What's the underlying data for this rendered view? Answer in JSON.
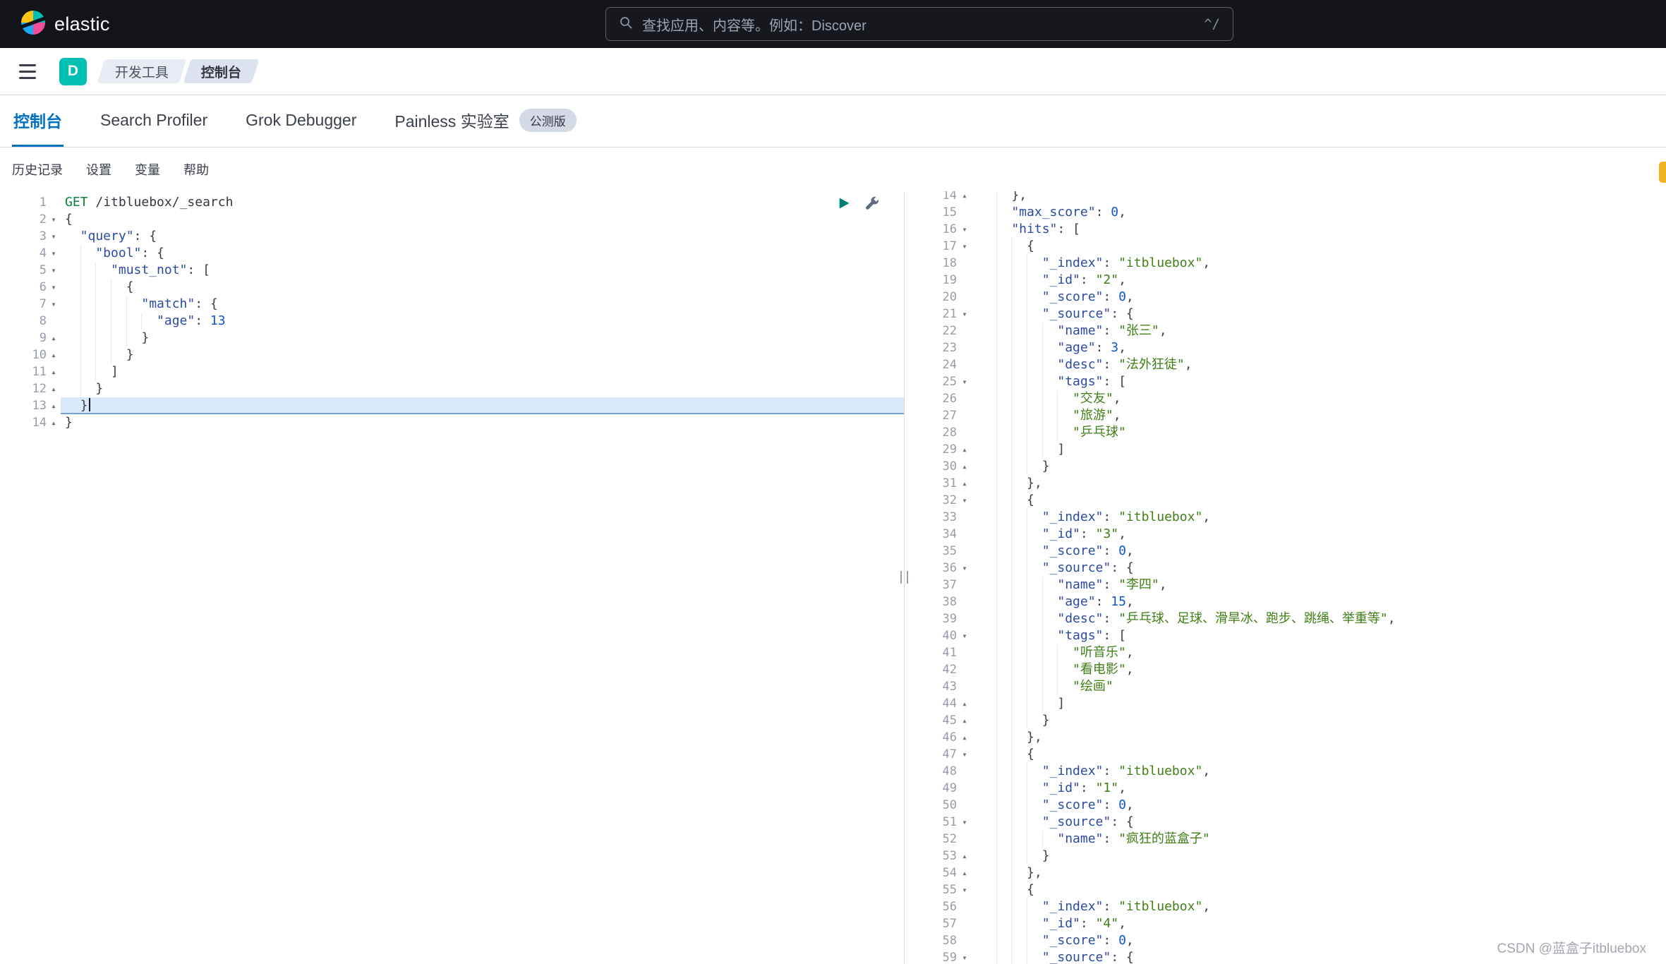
{
  "topbar": {
    "logo_text": "elastic",
    "search_placeholder": "查找应用、内容等。例如：Discover",
    "shortcut_hint": "^/"
  },
  "breadcrumb_bar": {
    "space_initial": "D",
    "breadcrumbs": [
      {
        "id": "dev-tools",
        "label": "开发工具"
      },
      {
        "id": "console",
        "label": "控制台"
      }
    ]
  },
  "tabs": {
    "items": [
      {
        "id": "console",
        "label": "控制台",
        "active": true
      },
      {
        "id": "search-profiler",
        "label": "Search Profiler",
        "active": false
      },
      {
        "id": "grok-debugger",
        "label": "Grok Debugger",
        "active": false
      },
      {
        "id": "painless-lab",
        "label": "Painless 实验室",
        "active": false,
        "badge": "公测版"
      }
    ]
  },
  "console_menu": {
    "items": [
      {
        "id": "history",
        "label": "历史记录"
      },
      {
        "id": "settings",
        "label": "设置"
      },
      {
        "id": "variables",
        "label": "变量"
      },
      {
        "id": "help",
        "label": "帮助"
      }
    ]
  },
  "editor": {
    "request": {
      "active_line": 13,
      "actions": [
        {
          "icon": "play-icon"
        },
        {
          "icon": "wrench-icon"
        }
      ],
      "lines": [
        {
          "n": 1,
          "i": 0,
          "f": "",
          "t": [
            [
              "meth",
              "GET"
            ],
            [
              "pun",
              " "
            ],
            [
              "url",
              "/itbluebox/_search"
            ]
          ]
        },
        {
          "n": 2,
          "i": 0,
          "f": "d",
          "t": [
            [
              "pun",
              "{"
            ]
          ]
        },
        {
          "n": 3,
          "i": 2,
          "f": "d",
          "t": [
            [
              "key",
              "\"query\""
            ],
            [
              "pun",
              ": {"
            ]
          ]
        },
        {
          "n": 4,
          "i": 4,
          "f": "d",
          "t": [
            [
              "key",
              "\"bool\""
            ],
            [
              "pun",
              ": {"
            ]
          ]
        },
        {
          "n": 5,
          "i": 6,
          "f": "d",
          "t": [
            [
              "key",
              "\"must_not\""
            ],
            [
              "pun",
              ": ["
            ]
          ]
        },
        {
          "n": 6,
          "i": 8,
          "f": "d",
          "t": [
            [
              "pun",
              "{"
            ]
          ]
        },
        {
          "n": 7,
          "i": 10,
          "f": "d",
          "t": [
            [
              "key",
              "\"match\""
            ],
            [
              "pun",
              ": {"
            ]
          ]
        },
        {
          "n": 8,
          "i": 12,
          "f": "",
          "t": [
            [
              "key",
              "\"age\""
            ],
            [
              "pun",
              ": "
            ],
            [
              "num",
              "13"
            ]
          ]
        },
        {
          "n": 9,
          "i": 10,
          "f": "u",
          "t": [
            [
              "pun",
              "}"
            ]
          ]
        },
        {
          "n": 10,
          "i": 8,
          "f": "u",
          "t": [
            [
              "pun",
              "}"
            ]
          ]
        },
        {
          "n": 11,
          "i": 6,
          "f": "u",
          "t": [
            [
              "pun",
              "]"
            ]
          ]
        },
        {
          "n": 12,
          "i": 4,
          "f": "u",
          "t": [
            [
              "pun",
              "}"
            ]
          ]
        },
        {
          "n": 13,
          "i": 2,
          "f": "u",
          "t": [
            [
              "pun",
              "}"
            ]
          ],
          "active": true,
          "caret": true
        },
        {
          "n": 14,
          "i": 0,
          "f": "u",
          "t": [
            [
              "pun",
              "}"
            ]
          ]
        }
      ]
    },
    "response": {
      "lines": [
        {
          "n": 14,
          "i": 4,
          "f": "u",
          "t": [
            [
              "pun",
              "},"
            ]
          ]
        },
        {
          "n": 15,
          "i": 4,
          "f": "",
          "t": [
            [
              "key",
              "\"max_score\""
            ],
            [
              "pun",
              ": "
            ],
            [
              "num",
              "0"
            ],
            [
              "pun",
              ","
            ]
          ]
        },
        {
          "n": 16,
          "i": 4,
          "f": "d",
          "t": [
            [
              "key",
              "\"hits\""
            ],
            [
              "pun",
              ": ["
            ]
          ]
        },
        {
          "n": 17,
          "i": 6,
          "f": "d",
          "t": [
            [
              "pun",
              "{"
            ]
          ]
        },
        {
          "n": 18,
          "i": 8,
          "f": "",
          "t": [
            [
              "key",
              "\"_index\""
            ],
            [
              "pun",
              ": "
            ],
            [
              "str",
              "\"itbluebox\""
            ],
            [
              "pun",
              ","
            ]
          ]
        },
        {
          "n": 19,
          "i": 8,
          "f": "",
          "t": [
            [
              "key",
              "\"_id\""
            ],
            [
              "pun",
              ": "
            ],
            [
              "str",
              "\"2\""
            ],
            [
              "pun",
              ","
            ]
          ]
        },
        {
          "n": 20,
          "i": 8,
          "f": "",
          "t": [
            [
              "key",
              "\"_score\""
            ],
            [
              "pun",
              ": "
            ],
            [
              "num",
              "0"
            ],
            [
              "pun",
              ","
            ]
          ]
        },
        {
          "n": 21,
          "i": 8,
          "f": "d",
          "t": [
            [
              "key",
              "\"_source\""
            ],
            [
              "pun",
              ": {"
            ]
          ]
        },
        {
          "n": 22,
          "i": 10,
          "f": "",
          "t": [
            [
              "key",
              "\"name\""
            ],
            [
              "pun",
              ": "
            ],
            [
              "str",
              "\"张三\""
            ],
            [
              "pun",
              ","
            ]
          ]
        },
        {
          "n": 23,
          "i": 10,
          "f": "",
          "t": [
            [
              "key",
              "\"age\""
            ],
            [
              "pun",
              ": "
            ],
            [
              "num",
              "3"
            ],
            [
              "pun",
              ","
            ]
          ]
        },
        {
          "n": 24,
          "i": 10,
          "f": "",
          "t": [
            [
              "key",
              "\"desc\""
            ],
            [
              "pun",
              ": "
            ],
            [
              "str",
              "\"法外狂徒\""
            ],
            [
              "pun",
              ","
            ]
          ]
        },
        {
          "n": 25,
          "i": 10,
          "f": "d",
          "t": [
            [
              "key",
              "\"tags\""
            ],
            [
              "pun",
              ": ["
            ]
          ]
        },
        {
          "n": 26,
          "i": 12,
          "f": "",
          "t": [
            [
              "str",
              "\"交友\""
            ],
            [
              "pun",
              ","
            ]
          ]
        },
        {
          "n": 27,
          "i": 12,
          "f": "",
          "t": [
            [
              "str",
              "\"旅游\""
            ],
            [
              "pun",
              ","
            ]
          ]
        },
        {
          "n": 28,
          "i": 12,
          "f": "",
          "t": [
            [
              "str",
              "\"乒乓球\""
            ]
          ]
        },
        {
          "n": 29,
          "i": 10,
          "f": "u",
          "t": [
            [
              "pun",
              "]"
            ]
          ]
        },
        {
          "n": 30,
          "i": 8,
          "f": "u",
          "t": [
            [
              "pun",
              "}"
            ]
          ]
        },
        {
          "n": 31,
          "i": 6,
          "f": "u",
          "t": [
            [
              "pun",
              "},"
            ]
          ]
        },
        {
          "n": 32,
          "i": 6,
          "f": "d",
          "t": [
            [
              "pun",
              "{"
            ]
          ]
        },
        {
          "n": 33,
          "i": 8,
          "f": "",
          "t": [
            [
              "key",
              "\"_index\""
            ],
            [
              "pun",
              ": "
            ],
            [
              "str",
              "\"itbluebox\""
            ],
            [
              "pun",
              ","
            ]
          ]
        },
        {
          "n": 34,
          "i": 8,
          "f": "",
          "t": [
            [
              "key",
              "\"_id\""
            ],
            [
              "pun",
              ": "
            ],
            [
              "str",
              "\"3\""
            ],
            [
              "pun",
              ","
            ]
          ]
        },
        {
          "n": 35,
          "i": 8,
          "f": "",
          "t": [
            [
              "key",
              "\"_score\""
            ],
            [
              "pun",
              ": "
            ],
            [
              "num",
              "0"
            ],
            [
              "pun",
              ","
            ]
          ]
        },
        {
          "n": 36,
          "i": 8,
          "f": "d",
          "t": [
            [
              "key",
              "\"_source\""
            ],
            [
              "pun",
              ": {"
            ]
          ]
        },
        {
          "n": 37,
          "i": 10,
          "f": "",
          "t": [
            [
              "key",
              "\"name\""
            ],
            [
              "pun",
              ": "
            ],
            [
              "str",
              "\"李四\""
            ],
            [
              "pun",
              ","
            ]
          ]
        },
        {
          "n": 38,
          "i": 10,
          "f": "",
          "t": [
            [
              "key",
              "\"age\""
            ],
            [
              "pun",
              ": "
            ],
            [
              "num",
              "15"
            ],
            [
              "pun",
              ","
            ]
          ]
        },
        {
          "n": 39,
          "i": 10,
          "f": "",
          "t": [
            [
              "key",
              "\"desc\""
            ],
            [
              "pun",
              ": "
            ],
            [
              "str",
              "\"乒乓球、足球、滑旱冰、跑步、跳绳、举重等\""
            ],
            [
              "pun",
              ","
            ]
          ]
        },
        {
          "n": 40,
          "i": 10,
          "f": "d",
          "t": [
            [
              "key",
              "\"tags\""
            ],
            [
              "pun",
              ": ["
            ]
          ]
        },
        {
          "n": 41,
          "i": 12,
          "f": "",
          "t": [
            [
              "str",
              "\"听音乐\""
            ],
            [
              "pun",
              ","
            ]
          ]
        },
        {
          "n": 42,
          "i": 12,
          "f": "",
          "t": [
            [
              "str",
              "\"看电影\""
            ],
            [
              "pun",
              ","
            ]
          ]
        },
        {
          "n": 43,
          "i": 12,
          "f": "",
          "t": [
            [
              "str",
              "\"绘画\""
            ]
          ]
        },
        {
          "n": 44,
          "i": 10,
          "f": "u",
          "t": [
            [
              "pun",
              "]"
            ]
          ]
        },
        {
          "n": 45,
          "i": 8,
          "f": "u",
          "t": [
            [
              "pun",
              "}"
            ]
          ]
        },
        {
          "n": 46,
          "i": 6,
          "f": "u",
          "t": [
            [
              "pun",
              "},"
            ]
          ]
        },
        {
          "n": 47,
          "i": 6,
          "f": "d",
          "t": [
            [
              "pun",
              "{"
            ]
          ]
        },
        {
          "n": 48,
          "i": 8,
          "f": "",
          "t": [
            [
              "key",
              "\"_index\""
            ],
            [
              "pun",
              ": "
            ],
            [
              "str",
              "\"itbluebox\""
            ],
            [
              "pun",
              ","
            ]
          ]
        },
        {
          "n": 49,
          "i": 8,
          "f": "",
          "t": [
            [
              "key",
              "\"_id\""
            ],
            [
              "pun",
              ": "
            ],
            [
              "str",
              "\"1\""
            ],
            [
              "pun",
              ","
            ]
          ]
        },
        {
          "n": 50,
          "i": 8,
          "f": "",
          "t": [
            [
              "key",
              "\"_score\""
            ],
            [
              "pun",
              ": "
            ],
            [
              "num",
              "0"
            ],
            [
              "pun",
              ","
            ]
          ]
        },
        {
          "n": 51,
          "i": 8,
          "f": "d",
          "t": [
            [
              "key",
              "\"_source\""
            ],
            [
              "pun",
              ": {"
            ]
          ]
        },
        {
          "n": 52,
          "i": 10,
          "f": "",
          "t": [
            [
              "key",
              "\"name\""
            ],
            [
              "pun",
              ": "
            ],
            [
              "str",
              "\"疯狂的蓝盒子\""
            ]
          ]
        },
        {
          "n": 53,
          "i": 8,
          "f": "u",
          "t": [
            [
              "pun",
              "}"
            ]
          ]
        },
        {
          "n": 54,
          "i": 6,
          "f": "u",
          "t": [
            [
              "pun",
              "},"
            ]
          ]
        },
        {
          "n": 55,
          "i": 6,
          "f": "d",
          "t": [
            [
              "pun",
              "{"
            ]
          ]
        },
        {
          "n": 56,
          "i": 8,
          "f": "",
          "t": [
            [
              "key",
              "\"_index\""
            ],
            [
              "pun",
              ": "
            ],
            [
              "str",
              "\"itbluebox\""
            ],
            [
              "pun",
              ","
            ]
          ]
        },
        {
          "n": 57,
          "i": 8,
          "f": "",
          "t": [
            [
              "key",
              "\"_id\""
            ],
            [
              "pun",
              ": "
            ],
            [
              "str",
              "\"4\""
            ],
            [
              "pun",
              ","
            ]
          ]
        },
        {
          "n": 58,
          "i": 8,
          "f": "",
          "t": [
            [
              "key",
              "\"_score\""
            ],
            [
              "pun",
              ": "
            ],
            [
              "num",
              "0"
            ],
            [
              "pun",
              ","
            ]
          ]
        },
        {
          "n": 59,
          "i": 8,
          "f": "d",
          "t": [
            [
              "key",
              "\"_source\""
            ],
            [
              "pun",
              ": {"
            ]
          ]
        }
      ]
    }
  },
  "watermark": "CSDN @蓝盒子itbluebox",
  "colors": {
    "header_bg": "#14151a",
    "brand_teal": "#00bfb3",
    "active_tab_blue": "#0071c2",
    "method_green": "#0e7d3e",
    "key_blue": "#2b4ba0",
    "string_green": "#3f7f16",
    "number_blue": "#1155cc",
    "active_line_bg": "#d8e9fa",
    "edge_widget_yellow": "#eeb41d"
  }
}
